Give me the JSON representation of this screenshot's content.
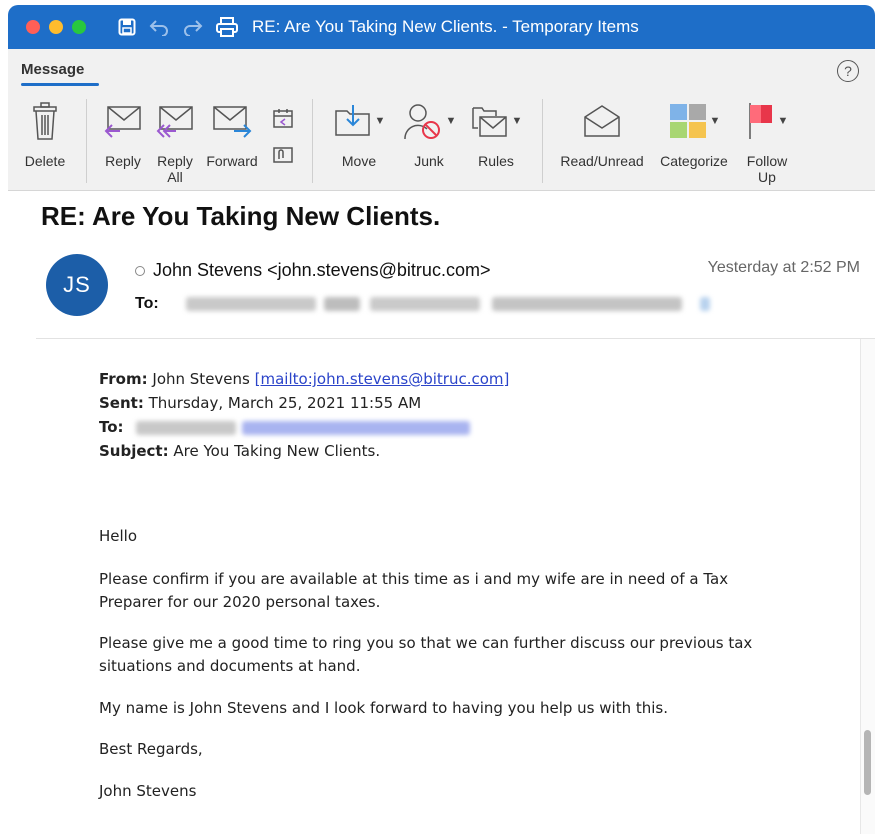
{
  "window": {
    "title": "RE: Are You Taking New Clients. - Temporary Items"
  },
  "ribbon": {
    "active_tab": "Message",
    "help_glyph": "?"
  },
  "toolbar": {
    "delete": "Delete",
    "reply": "Reply",
    "reply_all": "Reply\nAll",
    "forward": "Forward",
    "move": "Move",
    "junk": "Junk",
    "rules": "Rules",
    "read_unread": "Read/Unread",
    "categorize": "Categorize",
    "follow_up": "Follow\nUp"
  },
  "header": {
    "subject": "RE: Are You Taking New Clients.",
    "avatar_initials": "JS",
    "sender": "John Stevens <john.stevens@bitruc.com>",
    "timestamp": "Yesterday at 2:52 PM",
    "to_label": "To:"
  },
  "body": {
    "from_label": "From:",
    "from_name": "John Stevens",
    "from_link": "[mailto:john.stevens@bitruc.com]",
    "sent_label": "Sent:",
    "sent_value": "Thursday, March 25, 2021 11:55 AM",
    "to_label": "To:",
    "subject_label": "Subject:",
    "subject_value": "Are You Taking New Clients.",
    "greeting": "Hello",
    "para1_line1": "Please confirm if you are available at this time as i and my wife are in need of a Tax",
    "para1_line2": "Preparer for our 2020 personal taxes.",
    "para2_line1": "Please give me a good time to ring you so that we can further discuss our previous tax",
    "para2_line2": "situations and documents at hand.",
    "para3": "My name is John Stevens and I look forward to having you help us with this.",
    "closing": "Best Regards,",
    "signature": "John Stevens"
  },
  "colors": {
    "titlebar": "#1e6ec8",
    "avatar": "#1c5ea8",
    "link": "#2b44c9",
    "follow_up_flag": "#e8364a"
  }
}
